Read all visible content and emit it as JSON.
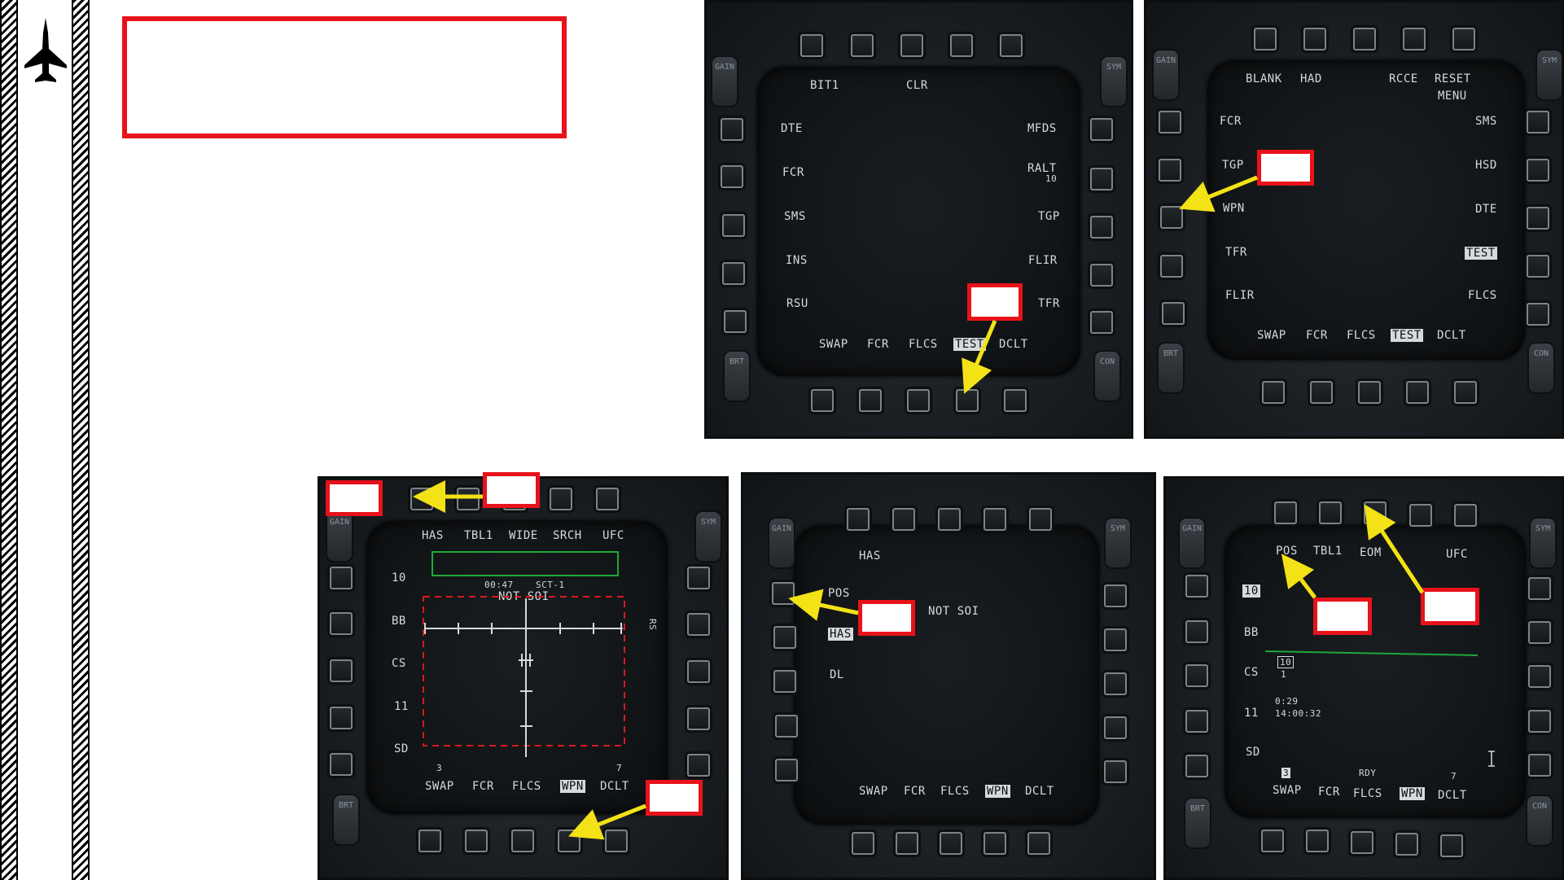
{
  "colors": {
    "callout": "#e8121b",
    "arrow": "#f2e216",
    "mfd_text": "#d6dadc",
    "green_line": "#1ea83a",
    "red_dash": "#d61a22"
  },
  "icons": {
    "jet": "f16-jet-icon"
  },
  "rockers": {
    "gain": "GAIN",
    "sym": "SYM",
    "brt": "BRT",
    "con": "CON"
  },
  "mfd_test": {
    "top": [
      "BIT1",
      "CLR"
    ],
    "left": [
      "DTE",
      "FCR",
      "SMS",
      "INS",
      "RSU"
    ],
    "right": [
      "MFDS",
      "RALT",
      "TGP",
      "FLIR",
      "TFR"
    ],
    "ralt_value": "10",
    "bottom": [
      "SWAP",
      "FCR",
      "FLCS",
      "TEST",
      "DCLT"
    ]
  },
  "mfd_menu": {
    "top": [
      "BLANK",
      "HAD",
      "RCCE",
      "RESET",
      "MENU"
    ],
    "left": [
      "FCR",
      "TGP",
      "WPN",
      "TFR",
      "FLIR"
    ],
    "right": [
      "SMS",
      "HSD",
      "DTE",
      "TEST",
      "FLCS"
    ],
    "bottom": [
      "SWAP",
      "FCR",
      "FLCS",
      "TEST",
      "DCLT"
    ]
  },
  "mfd_has": {
    "top": [
      "HAS",
      "TBL1",
      "WIDE",
      "SRCH",
      "UFC"
    ],
    "left": [
      "10",
      "BB",
      "CS",
      "11",
      "SD"
    ],
    "timer": "00:47",
    "sector": "SCT-1",
    "not_soi": "NOT SOI",
    "side_r": "RS",
    "corner_left": "3",
    "corner_right": "7",
    "bottom": [
      "SWAP",
      "FCR",
      "FLCS",
      "WPN",
      "DCLT"
    ]
  },
  "mfd_select": {
    "top_label": "HAS",
    "left": [
      "POS",
      "HAS",
      "DL"
    ],
    "not_soi": "NOT SOI",
    "bottom": [
      "SWAP",
      "FCR",
      "FLCS",
      "WPN",
      "DCLT"
    ]
  },
  "mfd_pos": {
    "top": [
      "POS",
      "TBL1",
      "EOM",
      "UFC"
    ],
    "left": [
      "10",
      "BB",
      "CS",
      "11",
      "SD"
    ],
    "counter_top": "10",
    "counter_bot": "1",
    "time1": "0:29",
    "time2": "14:00:32",
    "rdy": "RDY",
    "corner_left": "3",
    "corner_right": "7",
    "bottom": [
      "SWAP",
      "FCR",
      "FLCS",
      "WPN",
      "DCLT"
    ]
  }
}
